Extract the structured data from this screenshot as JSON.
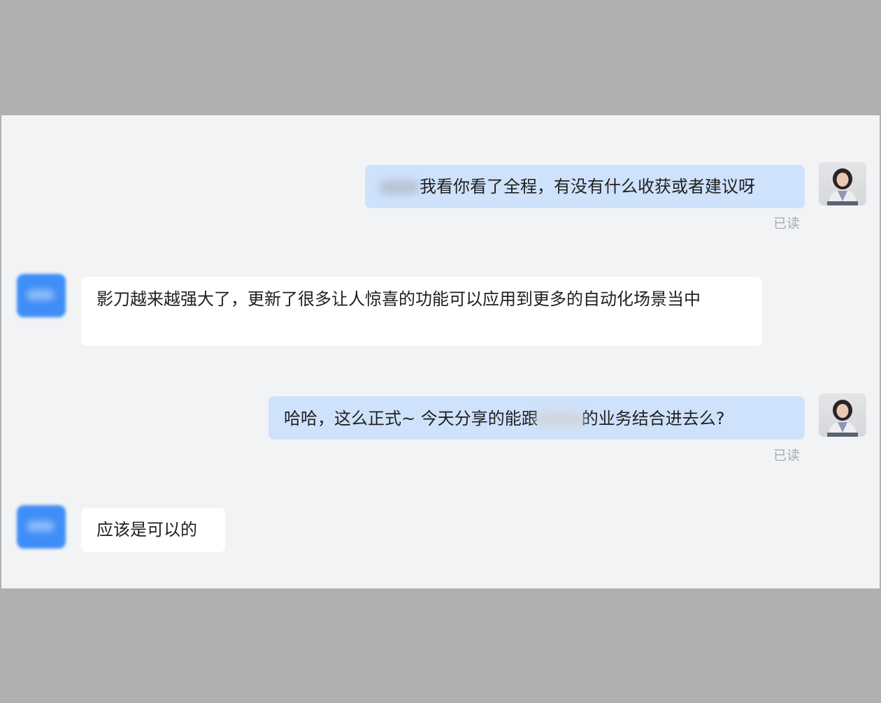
{
  "messages": [
    {
      "side": "sent",
      "text": "我看你看了全程，有没有什么收获或者建议呀",
      "status": "已读"
    },
    {
      "side": "received",
      "text": "影刀越来越强大了，更新了很多让人惊喜的功能可以应用到更多的自动化场景当中"
    },
    {
      "side": "sent",
      "text_before": "哈哈，这么正式~  今天分享的能跟",
      "text_after": "的业务结合进去么?",
      "status": "已读"
    },
    {
      "side": "received",
      "text": "应该是可以的"
    }
  ],
  "icons": {
    "self_avatar": "user-photo-avatar",
    "contact_avatar": "contact-avatar"
  },
  "colors": {
    "sent_bubble": "#cfe2fc",
    "received_bubble": "#ffffff",
    "chat_background": "#f2f3f5",
    "contact_avatar": "#3f8ef7",
    "outer_band": "#b1b0b1"
  }
}
